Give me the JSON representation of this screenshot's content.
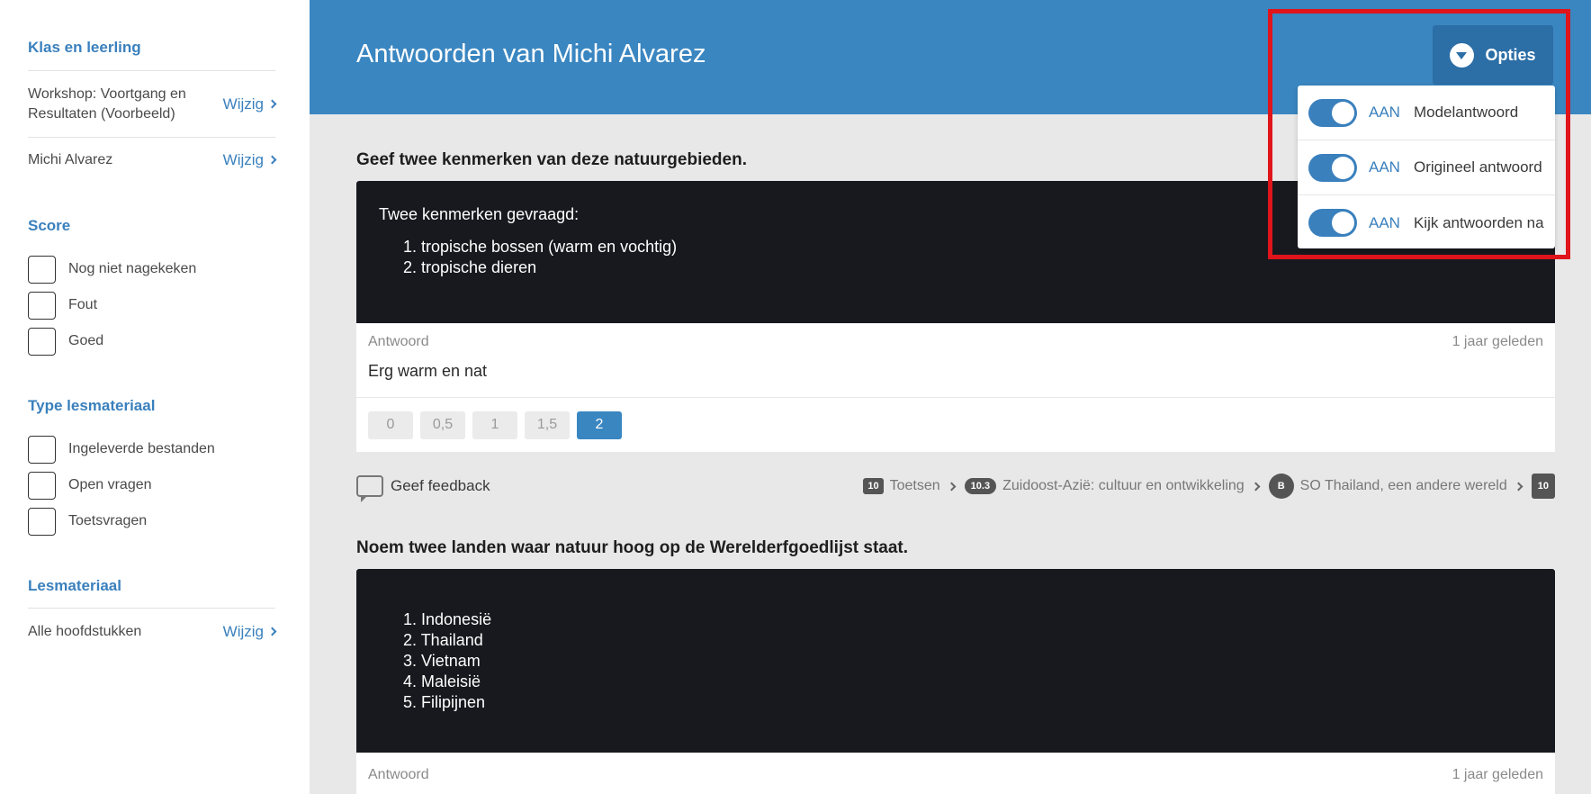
{
  "sidebar": {
    "section_class": "Klas en leerling",
    "class_row": {
      "text": "Workshop: Voortgang en Resultaten (Voorbeeld)",
      "link": "Wijzig"
    },
    "student_row": {
      "text": "Michi Alvarez",
      "link": "Wijzig"
    },
    "section_score": "Score",
    "score_items": [
      "Nog niet nagekeken",
      "Fout",
      "Goed"
    ],
    "section_type": "Type lesmateriaal",
    "type_items": [
      "Ingeleverde bestanden",
      "Open vragen",
      "Toetsvragen"
    ],
    "section_material": "Lesmateriaal",
    "material_row": {
      "text": "Alle hoofdstukken",
      "link": "Wijzig"
    }
  },
  "header": {
    "title": "Antwoorden van Michi Alvarez",
    "options_label": "Opties"
  },
  "options_menu": {
    "items": [
      {
        "state": "AAN",
        "label": "Modelantwoord"
      },
      {
        "state": "AAN",
        "label": "Origineel antwoord"
      },
      {
        "state": "AAN",
        "label": "Kijk antwoorden na"
      }
    ]
  },
  "questions": [
    {
      "title": "Geef twee kenmerken van deze natuurgebieden.",
      "model_intro": "Twee kenmerken gevraagd:",
      "model_list": [
        "1. tropische bossen (warm en vochtig)",
        "2. tropische dieren"
      ],
      "answer_label": "Antwoord",
      "answer_time": "1 jaar geleden",
      "answer_text": "Erg warm en nat",
      "scores": [
        "0",
        "0,5",
        "1",
        "1,5",
        "2"
      ],
      "selected_score": "2"
    },
    {
      "title": "Noem twee landen waar natuur hoog op de Werelderfgoedlijst staat.",
      "model_list": [
        "1. Indonesië",
        "2. Thailand",
        "3. Vietnam",
        "4. Maleisië",
        "5. Filipijnen"
      ],
      "answer_label": "Antwoord",
      "answer_time": "1 jaar geleden"
    }
  ],
  "feedback": {
    "label": "Geef feedback",
    "breadcrumb": [
      {
        "badge": "10",
        "text": "Toetsen"
      },
      {
        "badge": "10.3",
        "text": "Zuidoost-Azië: cultuur en ontwikkeling"
      },
      {
        "badge": "B",
        "text": "SO Thailand, een andere wereld"
      },
      {
        "badge": "10",
        "text": ""
      }
    ]
  }
}
